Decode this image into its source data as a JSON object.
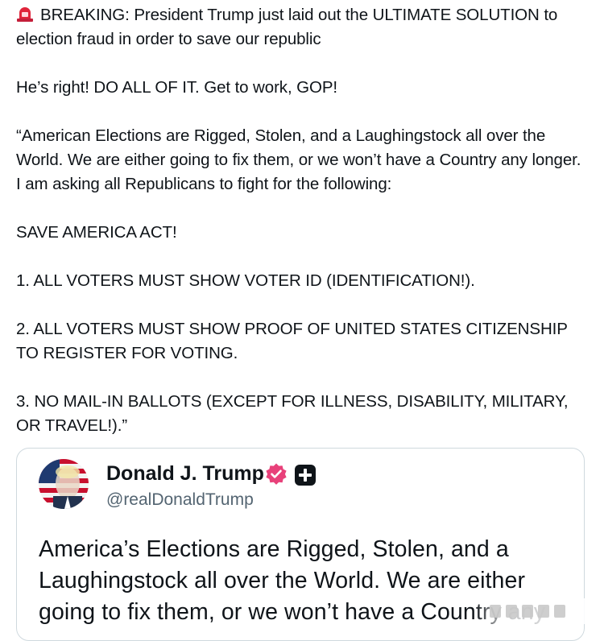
{
  "tweet": {
    "siren_icon": "police-car-light-emoji",
    "headline": "BREAKING: President Trump just laid out the ULTIMATE SOLUTION to election fraud in order to save our republic",
    "paragraphs": [
      "He’s right! DO ALL OF IT. Get to work, GOP!",
      "“American Elections are Rigged, Stolen, and a Laughingstock all over the World. We are either going to fix them, or we won’t have a Country any longer. I am asking all Republicans to fight for the following:",
      "SAVE AMERICA ACT!",
      "1. ALL VOTERS MUST SHOW VOTER ID (IDENTIFICATION!).",
      "2. ALL VOTERS MUST SHOW PROOF OF UNITED STATES CITIZENSHIP TO REGISTER FOR VOTING.",
      "3. NO MAIL-IN BALLOTS (EXCEPT FOR ILLNESS, DISABILITY, MILITARY, OR TRAVEL!).”"
    ]
  },
  "quoted_post": {
    "display_name": "Donald J. Trump",
    "handle": "@realDonaldTrump",
    "verified_icon": "verified-badge-icon",
    "plus_icon": "plus-badge-icon",
    "text": "America’s Elections are Rigged, Stolen, and a Laughingstock all over the World. We are either going to fix them, or we won’t have a Country any"
  },
  "colors": {
    "text": "#0f1419",
    "muted": "#536471",
    "border": "#cfd9de",
    "siren_red": "#e0243a",
    "verified_pink": "#e8417a"
  }
}
